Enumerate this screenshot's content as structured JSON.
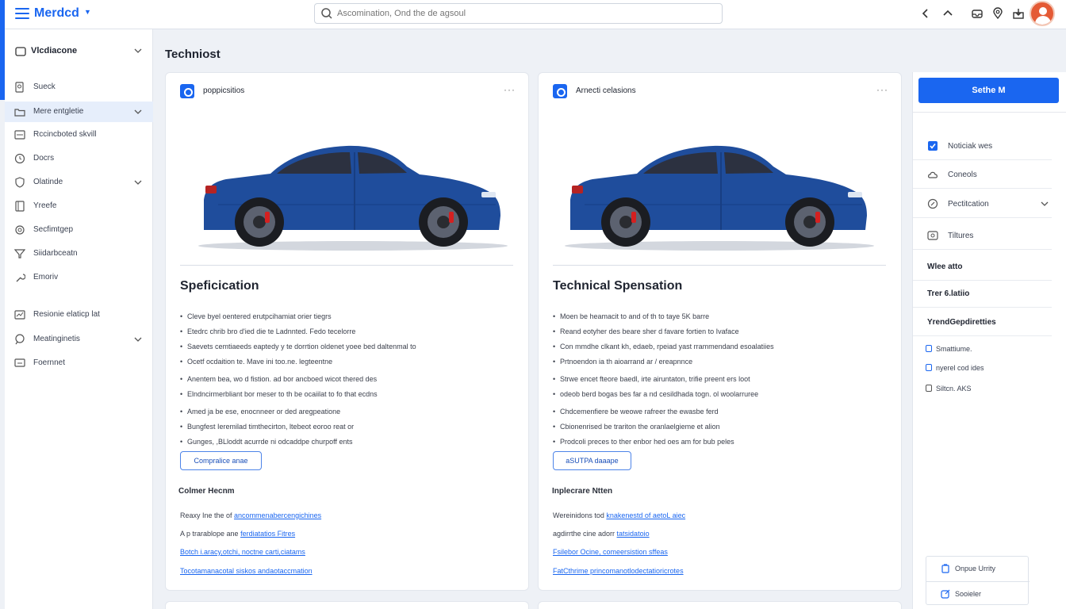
{
  "topbar": {
    "brand": "Merdcd",
    "search_placeholder": "Ascomination, Ond the de agsoul"
  },
  "sidebar": {
    "header": "Vlcdiacone",
    "items": [
      {
        "label": "Sueck",
        "icon": "search-doc-icon"
      },
      {
        "label": "Mere entgletie",
        "icon": "folder-icon",
        "active": true,
        "expandable": true
      },
      {
        "label": "Rccincboted skvill",
        "icon": "list-icon"
      },
      {
        "label": "Docrs",
        "icon": "clock-icon"
      },
      {
        "label": "Olatinde",
        "icon": "shield-icon",
        "expandable": true
      },
      {
        "label": "Yreefe",
        "icon": "book-icon"
      },
      {
        "label": "Secfimtgep",
        "icon": "settings-icon"
      },
      {
        "label": "Siidarbceatn",
        "icon": "filter-icon"
      },
      {
        "label": "Emoriv",
        "icon": "wrench-icon"
      },
      {
        "label": "Resionie elaticp lat",
        "icon": "chart-icon"
      },
      {
        "label": "Meatinginetis",
        "icon": "comment-icon",
        "expandable": true
      },
      {
        "label": "Foernnet",
        "icon": "monitor-icon"
      }
    ]
  },
  "main": {
    "page_title": "Techniost",
    "cards": [
      {
        "label": "poppicsitios",
        "heading": "Speficication",
        "bullets": [
          "Cleve byel oentered erutpcihamiat orier tiegrs",
          "Etedrc chrib bro d'ied die te Ladnnted. Fedo tecelorre",
          "Saevets cemtiaeeds eaptedy y te dorrtion oldenet yoee bed daltenmal to",
          "Ocetf ocdaition te. Mave ini too.ne. legteentne",
          "Anentem bea, wo d fistion. ad bor ancboed wicot thered des",
          "Elndncirmerbliant bor meser to th be ocaiilat to fo that ecdns",
          "Amed ja be ese, enocnneer or ded aregpeatione",
          "Bungfest Ieremilad timthecirton, ltebeot eoroo reat or",
          "Gunges, ,BLloddt acurrde ni odcaddpe churpoff ents"
        ],
        "button": "Compralice anae",
        "subheading": "Colmer Hecnm",
        "refs": [
          {
            "text": "Reaxy Ine the of ",
            "link": "ancommenabercengichines"
          },
          {
            "text": "A p trarablope ane ",
            "link": "ferdiatatios Fitres"
          },
          {
            "text": "",
            "link": "Botch i.aracy,otchi, noctne carti,ciatams"
          },
          {
            "text": "",
            "link": "Tocotamanacotal siskos andaotaccmation"
          }
        ]
      },
      {
        "label": "Arnecti celasions",
        "heading": "Technical Spensation",
        "bullets": [
          "Moen be heamacit to and of th to taye 5K barre",
          "Reand eotyher des beare sher d favare fortien to Ivaface",
          "Con mmdhe clkant kh, edaeb, rpeiad yast rrammendand esoalatiies",
          "Prtnoendon ia th aioarrand ar / ereapnnce",
          "Strwe encet fteore baedl, irte airuntaton, trifie preent ers loot",
          "odeob berd bogas bes far a nd cesildhada togn. ol woolarruree",
          "Chdcemenfiere be weowe rafreer the ewasbe ferd",
          "Cbionenrised be trariton the oranlaelgieme et alion",
          "Prodcoli preces to ther enbor hed oes am for bub peles"
        ],
        "button": "aSUTPA daaape",
        "subheading": "Inplecrare Ntten",
        "refs": [
          {
            "text": "Wereinidons tod ",
            "link": "knakenestd of aetoL aiec"
          },
          {
            "text": "agdirrthe cine adorr ",
            "link": "tatsidatoio"
          },
          {
            "text": "",
            "link": "Fsilebor Ocine, comeersistion sffeas"
          },
          {
            "text": "",
            "link": "FatCthrime princomanotlodectatioricrotes"
          }
        ]
      }
    ]
  },
  "rpanel": {
    "primary_button": "Sethe M",
    "items": [
      {
        "label": "Noticiak wes",
        "icon": "checkbox-icon"
      },
      {
        "label": "Coneols",
        "icon": "cloud-icon"
      },
      {
        "label": "Pectitcation",
        "icon": "pencil-icon",
        "expandable": true
      },
      {
        "label": "Tiltures",
        "icon": "image-icon"
      }
    ],
    "sections": [
      "Wlee atto",
      "Trer 6.latiio",
      "YrendGepdiretties"
    ],
    "checks": [
      "Smattiume.",
      "nyerel cod ides",
      "Siltcn. AKS"
    ],
    "bottom_card": [
      {
        "label": "Onpue Urrity",
        "icon": "clipboard-icon"
      },
      {
        "label": "Sooieler",
        "icon": "share-icon"
      }
    ]
  },
  "colors": {
    "accent": "#1a66f0",
    "car_body": "#1f4d9c",
    "brake_caliper": "#d42020"
  }
}
